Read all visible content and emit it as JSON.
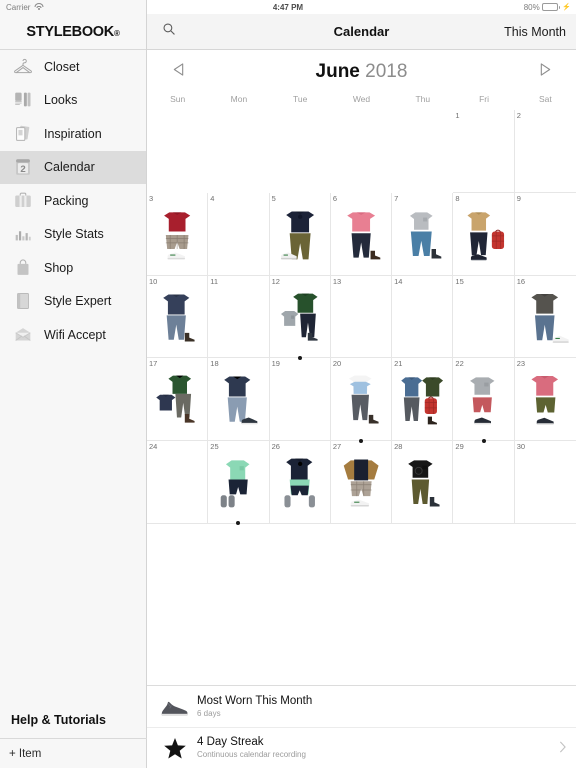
{
  "statusbar": {
    "carrier": "Carrier",
    "wifi_icon": "wifi-icon",
    "time": "4:47 PM",
    "battery_percent": "80%",
    "battery_icon": "battery-icon",
    "charging_icon": "lightning-bolt-icon"
  },
  "sidebar": {
    "brand": "STYLEBOOK",
    "brand_mark": "®",
    "items": [
      {
        "label": "Closet",
        "icon": "hanger-icon"
      },
      {
        "label": "Looks",
        "icon": "looks-icon"
      },
      {
        "label": "Inspiration",
        "icon": "inspiration-icon"
      },
      {
        "label": "Calendar",
        "icon": "calendar-icon",
        "active": true
      },
      {
        "label": "Packing",
        "icon": "suitcase-icon"
      },
      {
        "label": "Style Stats",
        "icon": "bar-chart-icon"
      },
      {
        "label": "Shop",
        "icon": "shopping-bag-icon"
      },
      {
        "label": "Style Expert",
        "icon": "book-icon"
      },
      {
        "label": "Wifi Accept",
        "icon": "envelope-icon"
      }
    ],
    "help": "Help & Tutorials",
    "add_item": "+ Item"
  },
  "topbar": {
    "search_icon": "search-icon",
    "title": "Calendar",
    "this_month": "This Month"
  },
  "monthbar": {
    "prev_icon": "triangle-left-icon",
    "next_icon": "triangle-right-icon",
    "month": "June",
    "year": "2018"
  },
  "weekdays": [
    "Sun",
    "Mon",
    "Tue",
    "Wed",
    "Thu",
    "Fri",
    "Sat"
  ],
  "calendar": {
    "weeks": [
      [
        {
          "day": "",
          "outfit": null,
          "dot": false,
          "empty": true
        },
        {
          "day": "",
          "outfit": null,
          "dot": false,
          "empty": true
        },
        {
          "day": "",
          "outfit": null,
          "dot": false,
          "empty": true
        },
        {
          "day": "",
          "outfit": null,
          "dot": false,
          "empty": true
        },
        {
          "day": "",
          "outfit": null,
          "dot": false,
          "empty": true
        },
        {
          "day": "1",
          "outfit": null,
          "dot": false
        },
        {
          "day": "2",
          "outfit": null,
          "dot": false
        }
      ],
      [
        {
          "day": "3",
          "outfit": "red-sweater-plaid-shorts-sneaker",
          "dot": false
        },
        {
          "day": "4",
          "outfit": null,
          "dot": false
        },
        {
          "day": "5",
          "outfit": "navy-hoodie-olive-pants-sneaker",
          "dot": false
        },
        {
          "day": "6",
          "outfit": "pink-shirt-navy-jeans-boot",
          "dot": false
        },
        {
          "day": "7",
          "outfit": "gray-tee-blue-jeans-hightop",
          "dot": false
        },
        {
          "day": "8",
          "outfit": "tan-sweater-navy-pants-red-bag",
          "dot": false
        },
        {
          "day": "9",
          "outfit": null,
          "dot": false
        }
      ],
      [
        {
          "day": "10",
          "outfit": "navy-sweater-jeans-boot",
          "dot": false
        },
        {
          "day": "11",
          "outfit": null,
          "dot": false
        },
        {
          "day": "12",
          "outfit": "green-jacket-gray-tee-navy-pants",
          "dot": true
        },
        {
          "day": "13",
          "outfit": null,
          "dot": false
        },
        {
          "day": "14",
          "outfit": null,
          "dot": false
        },
        {
          "day": "15",
          "outfit": null,
          "dot": false
        },
        {
          "day": "16",
          "outfit": "gray-jacket-jeans-white-shoe",
          "dot": false
        }
      ],
      [
        {
          "day": "17",
          "outfit": "green-jacket-navy-sweater-boot",
          "dot": false
        },
        {
          "day": "18",
          "outfit": "navy-sweater-light-jeans-sneaker",
          "dot": false
        },
        {
          "day": "19",
          "outfit": null,
          "dot": false
        },
        {
          "day": "20",
          "outfit": "white-blue-tee-gray-pants-boot",
          "dot": true
        },
        {
          "day": "21",
          "outfit": "denim-shirt-olive-jacket-red-bag",
          "dot": false
        },
        {
          "day": "22",
          "outfit": "gray-tee-red-shorts-sneaker",
          "dot": true
        },
        {
          "day": "23",
          "outfit": "pink-shirt-olive-shorts-sneaker",
          "dot": false
        }
      ],
      [
        {
          "day": "24",
          "outfit": null,
          "dot": false
        },
        {
          "day": "25",
          "outfit": "mint-tee-navy-shorts-sandal",
          "dot": true
        },
        {
          "day": "26",
          "outfit": "navy-hoodie-mint-shorts-sandal",
          "dot": false
        },
        {
          "day": "27",
          "outfit": "tan-navy-top-plaid-shorts-sneaker",
          "dot": false
        },
        {
          "day": "28",
          "outfit": "black-tee-olive-pants-hightop",
          "dot": false
        },
        {
          "day": "29",
          "outfit": null,
          "dot": false
        },
        {
          "day": "30",
          "outfit": null,
          "dot": false
        }
      ]
    ]
  },
  "bottom_panel": {
    "rows": [
      {
        "icon": "sneaker-icon",
        "title": "Most Worn This Month",
        "subtitle": "6 days",
        "chevron": false
      },
      {
        "icon": "star-icon",
        "title": "4 Day Streak",
        "subtitle": "Continuous calendar recording",
        "chevron": true
      }
    ],
    "chevron_icon": "chevron-right-icon"
  },
  "colors": {
    "sidebar_bg": "#f7f7f7",
    "active_item": "#dcdcdc",
    "topbar_bg": "#f4f4f4",
    "grid_line": "#e6e6e6",
    "battery_green": "#4cd964"
  }
}
